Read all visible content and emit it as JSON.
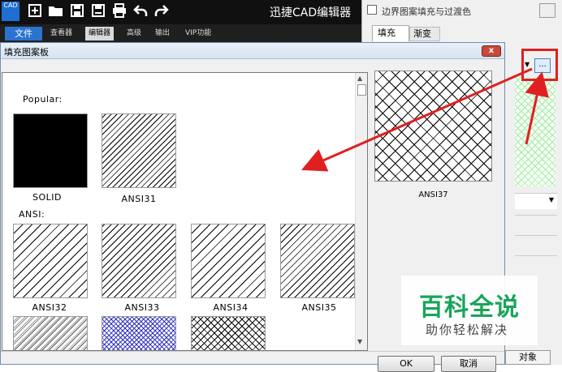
{
  "app": {
    "title": "迅捷CAD编辑器",
    "logo_text": "CAD",
    "toolbar_icons": [
      "new-icon",
      "open-folder-icon",
      "save-icon",
      "save-as-icon",
      "print-icon",
      "undo-icon",
      "redo-icon"
    ]
  },
  "menu": {
    "items": [
      "文件",
      "查看器",
      "编辑器",
      "高级",
      "输出",
      "VIP功能"
    ]
  },
  "background_window": {
    "title": "边界图案填充与过渡色",
    "tabs": [
      "填充",
      "渐变"
    ],
    "browse_button": "...",
    "object_button": "对象"
  },
  "dialog": {
    "title": "填充图案板",
    "close_label": "x",
    "sections": [
      "Popular:",
      "ANSI:"
    ],
    "popular": [
      {
        "name": "SOLID",
        "pattern": "solid"
      },
      {
        "name": "ANSI31",
        "pattern": "hatch"
      }
    ],
    "ansi": [
      {
        "name": "ANSI32",
        "pattern": "hatch-wide"
      },
      {
        "name": "ANSI33",
        "pattern": "hatch-double"
      },
      {
        "name": "ANSI34",
        "pattern": "hatch-wide"
      },
      {
        "name": "ANSI35",
        "pattern": "hatch-dense"
      },
      {
        "name": "",
        "pattern": "dotted"
      },
      {
        "name": "",
        "pattern": "cross-blue"
      },
      {
        "name": "",
        "pattern": "cross-small"
      }
    ],
    "preview": {
      "name": "ANSI37",
      "pattern": "cross"
    },
    "buttons": {
      "ok": "OK",
      "cancel": "取消"
    }
  },
  "watermark": {
    "main": "百科全说",
    "sub": "助你轻松解决"
  },
  "colors": {
    "annotation_red": "#e02020",
    "watermark_green": "#19a55b",
    "menu_active_blue": "#2a73cf"
  }
}
